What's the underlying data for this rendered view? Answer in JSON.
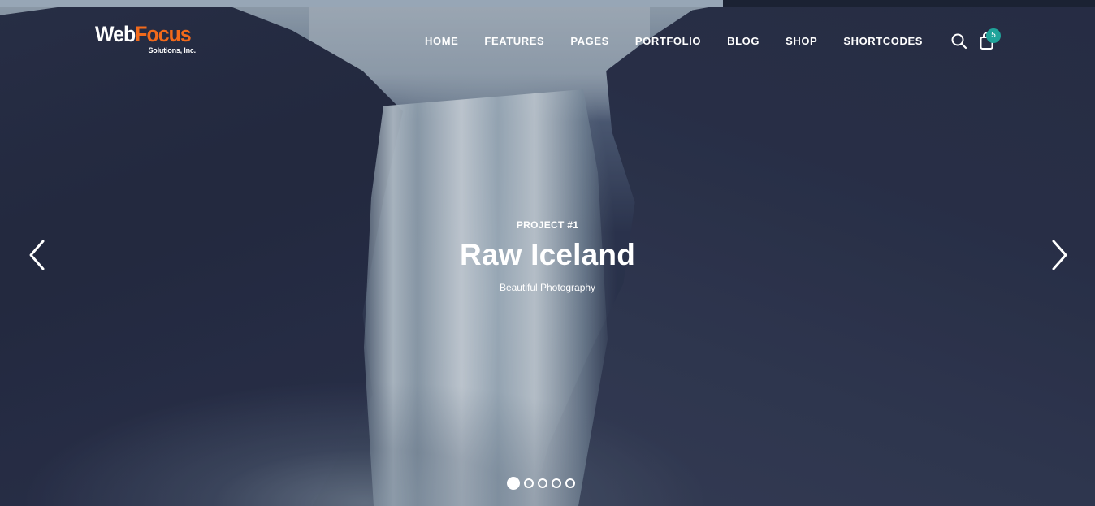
{
  "brand": {
    "logo_part1": "Web",
    "logo_part2": "Focus",
    "logo_tagline": "Solutions, Inc.",
    "accent_color": "#f26a1b"
  },
  "nav": {
    "items": [
      {
        "label": "HOME"
      },
      {
        "label": "FEATURES"
      },
      {
        "label": "PAGES"
      },
      {
        "label": "PORTFOLIO"
      },
      {
        "label": "BLOG"
      },
      {
        "label": "SHOP"
      },
      {
        "label": "SHORTCODES"
      }
    ],
    "search_icon": "search-icon",
    "cart_icon": "shopping-bag-icon",
    "cart_count": "5",
    "badge_color": "#1fa39a"
  },
  "slider": {
    "progress": 0.66,
    "eyebrow": "PROJECT #1",
    "title": "Raw Iceland",
    "subtitle": "Beautiful Photography",
    "prev_icon": "chevron-left-icon",
    "next_icon": "chevron-right-icon",
    "slide_count": 5,
    "active_slide": 1
  }
}
